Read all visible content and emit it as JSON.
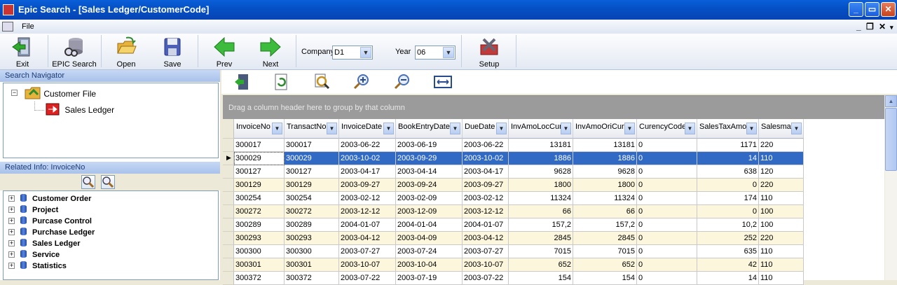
{
  "window": {
    "title": "Epic Search - [Sales Ledger/CustomerCode]"
  },
  "menu": {
    "file": "File"
  },
  "toolbar": {
    "buttons": [
      {
        "name": "exit-button",
        "label": "Exit",
        "icon": "exit-door-icon"
      },
      {
        "name": "epic-search-button",
        "label": "EPIC Search",
        "icon": "database-search-icon"
      },
      {
        "name": "open-button",
        "label": "Open",
        "icon": "open-folder-icon"
      },
      {
        "name": "save-button",
        "label": "Save",
        "icon": "floppy-disk-icon"
      },
      {
        "name": "prev-button",
        "label": "Prev",
        "icon": "green-arrow-left-icon"
      },
      {
        "name": "next-button",
        "label": "Next",
        "icon": "green-arrow-right-icon"
      },
      {
        "name": "setup-button",
        "label": "Setup",
        "icon": "tools-setup-icon"
      }
    ],
    "company_label": "Company",
    "company_value": "D1",
    "year_label": "Year",
    "year_value": "06"
  },
  "left": {
    "navigator_title": "Search Navigator",
    "tree_root": "Customer File",
    "tree_child": "Sales Ledger",
    "related_title": "Related Info: InvoiceNo",
    "related_items": [
      "Customer Order",
      "Project",
      "Purcase Control",
      "Purchase Ledger",
      "Sales Ledger",
      "Service",
      "Statistics"
    ]
  },
  "grid": {
    "group_hint": "Drag a column header here to group by that column",
    "columns": [
      "InvoiceNo",
      "TransactNo",
      "InvoiceDate",
      "BookEntryDate",
      "DueDate",
      "InvAmoLocCur",
      "InvAmoOriCur",
      "CurencyCode",
      "SalesTaxAmo",
      "Salesman"
    ],
    "rows": [
      [
        "300017",
        "300017",
        "2003-06-22",
        "2003-06-19",
        "2003-06-22",
        "13181",
        "13181",
        "0",
        "1171",
        "220"
      ],
      [
        "300029",
        "300029",
        "2003-10-02",
        "2003-09-29",
        "2003-10-02",
        "1886",
        "1886",
        "0",
        "14",
        "110"
      ],
      [
        "300127",
        "300127",
        "2003-04-17",
        "2003-04-14",
        "2003-04-17",
        "9628",
        "9628",
        "0",
        "638",
        "120"
      ],
      [
        "300129",
        "300129",
        "2003-09-27",
        "2003-09-24",
        "2003-09-27",
        "1800",
        "1800",
        "0",
        "0",
        "220"
      ],
      [
        "300254",
        "300254",
        "2003-02-12",
        "2003-02-09",
        "2003-02-12",
        "11324",
        "11324",
        "0",
        "174",
        "110"
      ],
      [
        "300272",
        "300272",
        "2003-12-12",
        "2003-12-09",
        "2003-12-12",
        "66",
        "66",
        "0",
        "0",
        "100"
      ],
      [
        "300289",
        "300289",
        "2004-01-07",
        "2004-01-04",
        "2004-01-07",
        "157,2",
        "157,2",
        "0",
        "10,2",
        "100"
      ],
      [
        "300293",
        "300293",
        "2003-04-12",
        "2003-04-09",
        "2003-04-12",
        "2845",
        "2845",
        "0",
        "252",
        "220"
      ],
      [
        "300300",
        "300300",
        "2003-07-27",
        "2003-07-24",
        "2003-07-27",
        "7015",
        "7015",
        "0",
        "635",
        "110"
      ],
      [
        "300301",
        "300301",
        "2003-10-07",
        "2003-10-04",
        "2003-10-07",
        "652",
        "652",
        "0",
        "42",
        "110"
      ],
      [
        "300372",
        "300372",
        "2003-07-22",
        "2003-07-19",
        "2003-07-22",
        "154",
        "154",
        "0",
        "14",
        "110"
      ]
    ],
    "selected_row": 1,
    "colors": {
      "selected": "#316ac5",
      "alt": "#fbf6dc"
    }
  }
}
